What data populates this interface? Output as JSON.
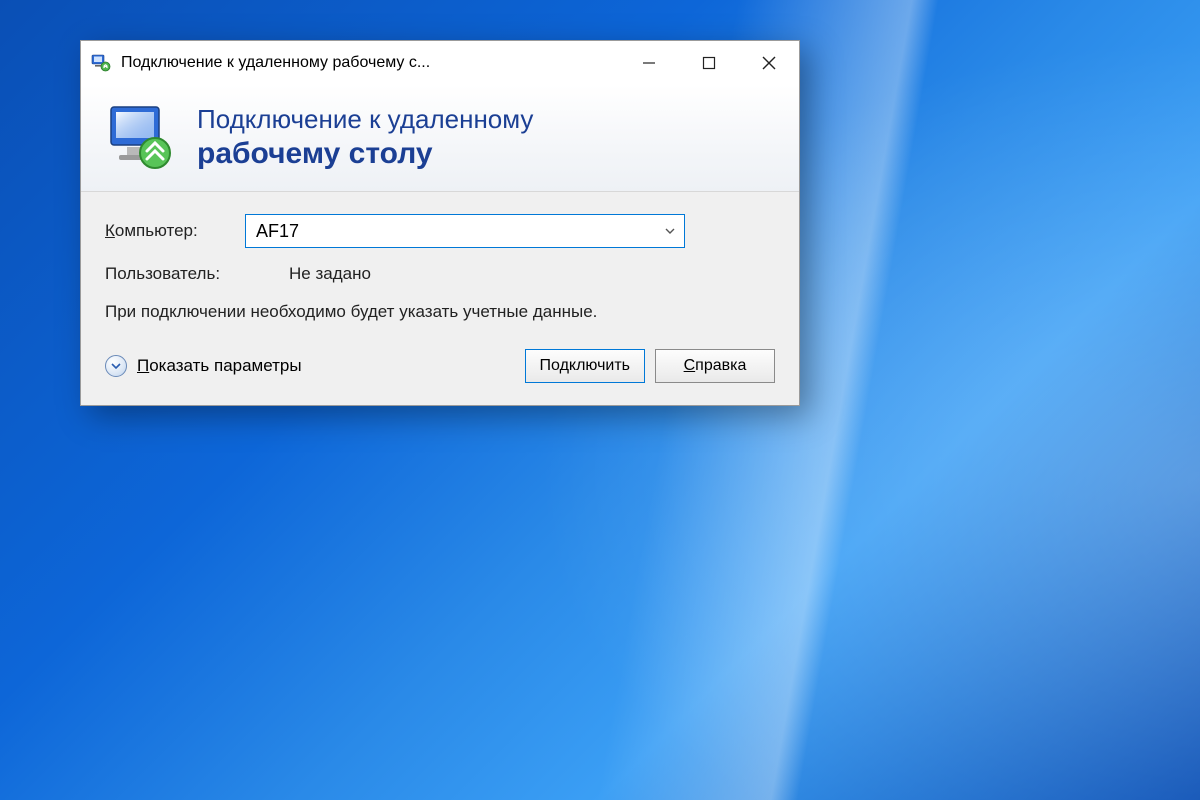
{
  "titlebar": {
    "title": "Подключение к удаленному рабочему с..."
  },
  "banner": {
    "line1": "Подключение к удаленному",
    "line2": "рабочему столу"
  },
  "form": {
    "computer_label_prefix": "К",
    "computer_label_rest": "омпьютер:",
    "computer_value": "AF17",
    "user_label": "Пользователь:",
    "user_value": "Не задано",
    "info_text": "При подключении необходимо будет указать учетные данные."
  },
  "footer": {
    "expand_label_prefix": "П",
    "expand_label_rest": "оказать параметры",
    "connect_label": "Подключить",
    "help_label_prefix": "С",
    "help_label_rest": "правка"
  }
}
